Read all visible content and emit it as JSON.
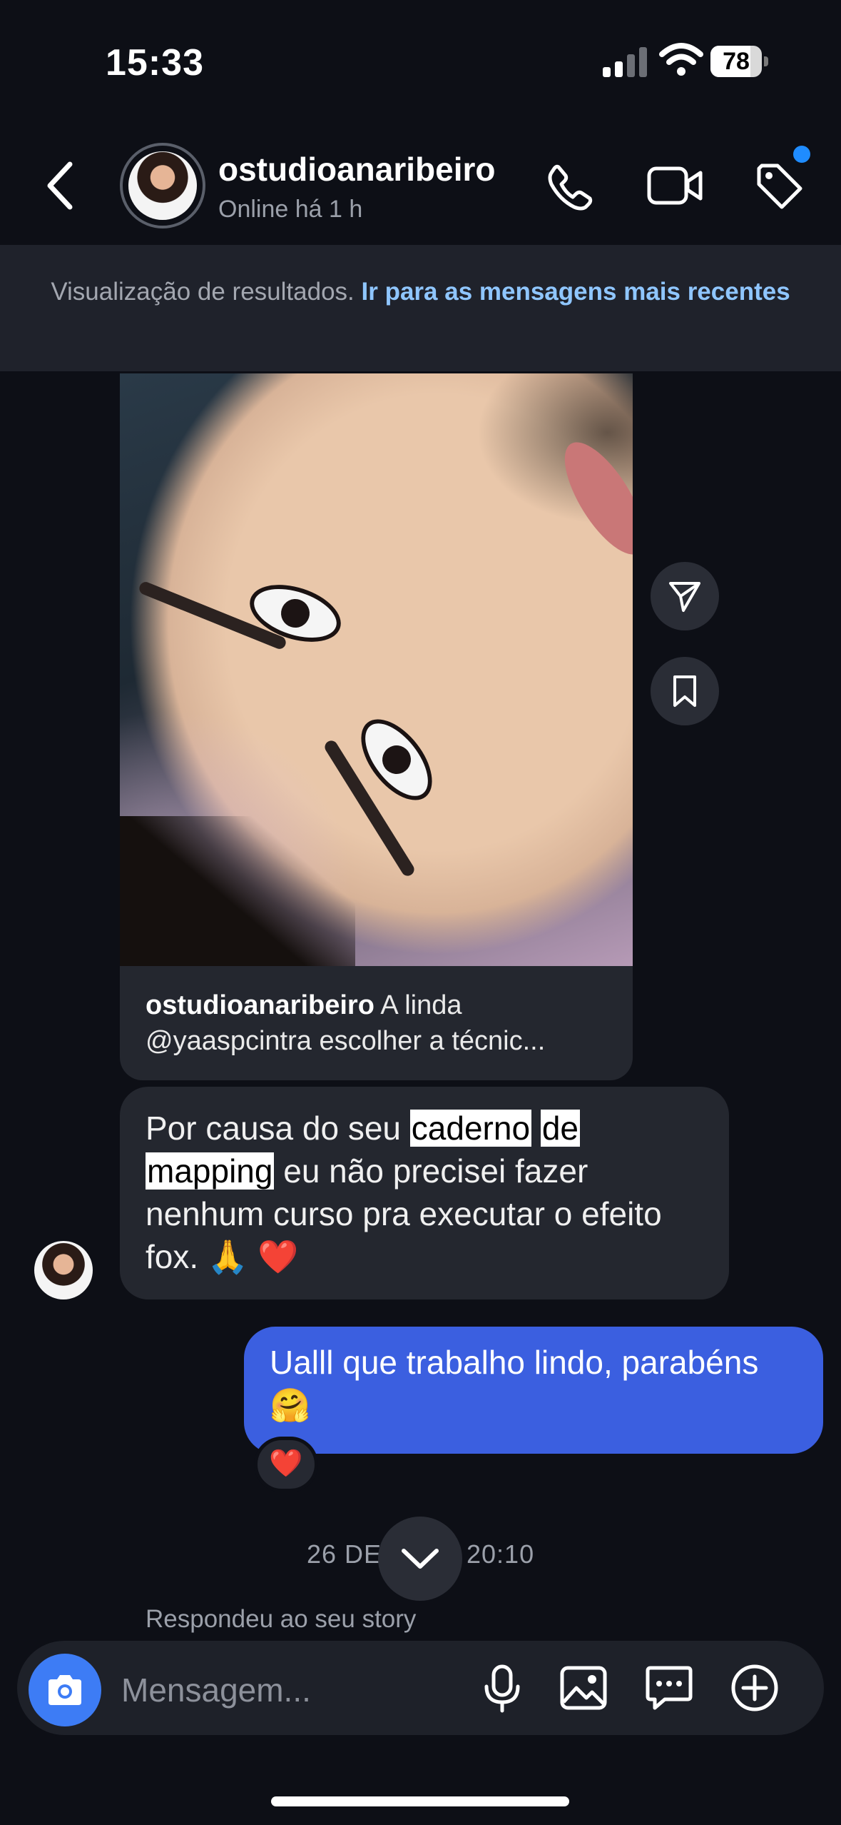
{
  "status_bar": {
    "time": "15:33",
    "battery": "78",
    "battery_level": 0.78
  },
  "header": {
    "username": "ostudioanaribeiro",
    "presence": "Online há 1 h",
    "icons": [
      "back-icon",
      "phone-icon",
      "video-camera-icon",
      "tag-icon"
    ],
    "notification_dot_color": "#1f8cff"
  },
  "banner": {
    "text": "Visualização de resultados. ",
    "link": "Ir para as mensagens mais recentes"
  },
  "shared_post": {
    "user": "ostudioanaribeiro",
    "caption_line1": "A linda",
    "caption_line2": "@yaaspcintra escolher a técnic..."
  },
  "messages": {
    "received": {
      "t1": "Por causa do seu ",
      "hl1": "caderno",
      "t2": " ",
      "hl2": "de",
      "t3": " ",
      "hl3": "mapping",
      "t4": " eu não precisei fazer nenhum curso pra executar o efeito fox. 🙏 ❤️"
    },
    "sent": {
      "text": "Ualll que trabalho lindo, parabéns 🤗"
    },
    "sent_reaction": "❤️"
  },
  "timestamp": {
    "left": "26 DE",
    "right": "20:10"
  },
  "story_reply": "Respondeu ao seu story",
  "composer": {
    "placeholder": "Mensagem..."
  },
  "colors": {
    "background": "#0d0f16",
    "sent_bubble": "#3b5fe0",
    "received_bubble": "#24272f",
    "link": "#8fc6ff",
    "camera_button": "#3d7cf5"
  }
}
